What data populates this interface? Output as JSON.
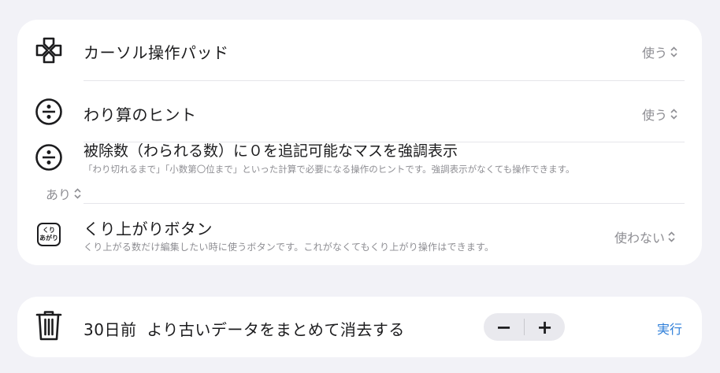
{
  "settings": {
    "rows": [
      {
        "title": "カーソル操作パッド",
        "value": "使う",
        "icon": "dpad-icon"
      },
      {
        "title": "わり算のヒント",
        "value": "使う",
        "icon": "divide-icon"
      },
      {
        "title": "被除数（わられる数）に０を追記可能なマスを強調表示",
        "subtitle": "「わり切れるまで」「小数第〇位まで」といった計算で必要になる操作のヒントです。強調表示がなくても操作できます。",
        "value": "あり",
        "icon": "divide-icon"
      },
      {
        "title": "くり上がりボタン",
        "subtitle": "くり上がる数だけ編集したい時に使うボタンです。これがなくてもくり上がり操作はできます。",
        "value": "使わない",
        "icon": "carry-badge-icon",
        "badge_line1": "くり",
        "badge_line2": "あがり"
      }
    ]
  },
  "cleanup": {
    "days_label": "30日前",
    "text": "より古いデータをまとめて消去する",
    "decrement": "−",
    "increment": "+",
    "run_label": "実行",
    "icon": "trash-icon"
  },
  "colors": {
    "accent": "#2f7fd9",
    "background": "#f2f2f7",
    "card": "#ffffff",
    "secondary_text": "#8e8e93"
  }
}
